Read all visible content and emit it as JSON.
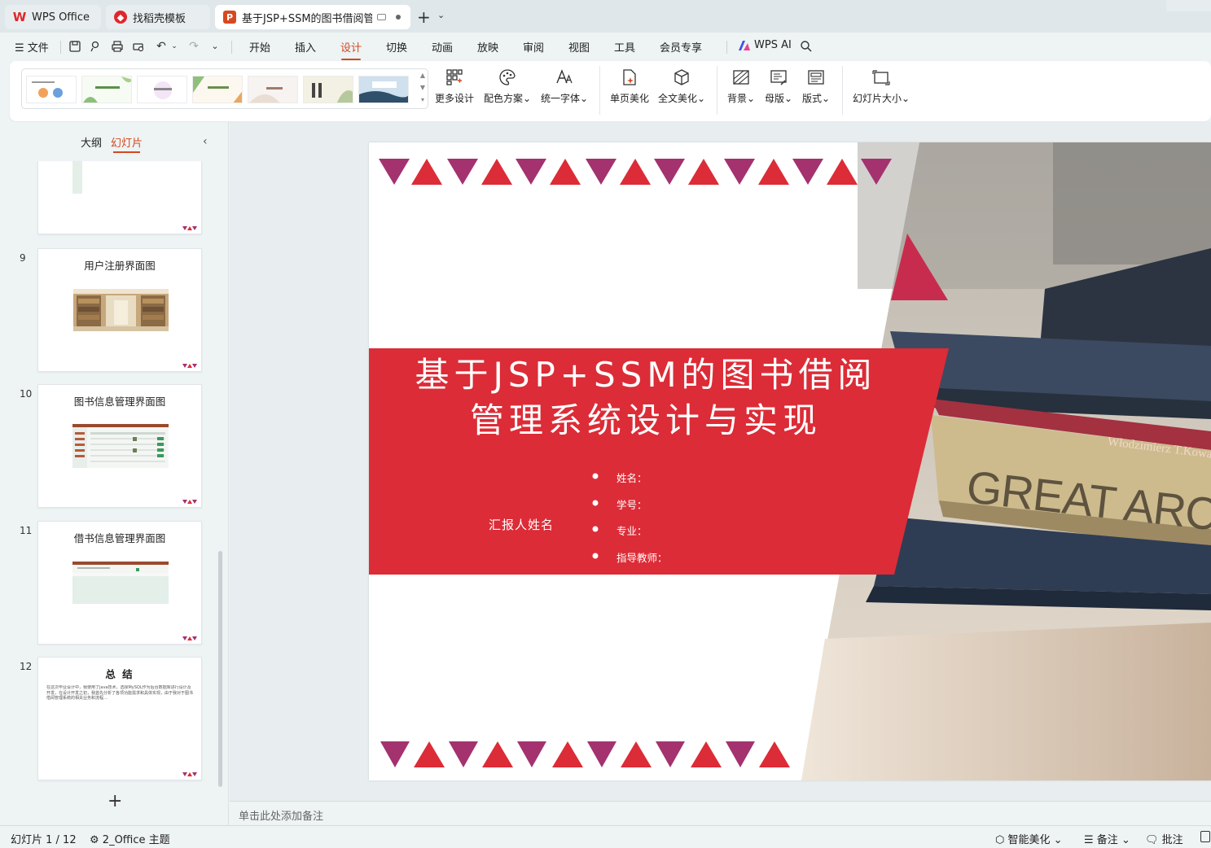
{
  "tabs": {
    "wps": "WPS Office",
    "template": "找稻壳模板",
    "document": "基于JSP+SSM的图书借阅管理"
  },
  "menu": {
    "file": "文件",
    "items": [
      "开始",
      "插入",
      "设计",
      "切换",
      "动画",
      "放映",
      "审阅",
      "视图",
      "工具",
      "会员专享"
    ],
    "active": "设计",
    "wps_ai": "WPS AI"
  },
  "ribbon": {
    "more_design": "更多设计",
    "color_scheme": "配色方案",
    "unify_font": "统一字体",
    "single_page_beautify": "单页美化",
    "full_beautify": "全文美化",
    "background": "背景",
    "master": "母版",
    "layout": "版式",
    "slide_size": "幻灯片大小"
  },
  "left_panel": {
    "tab_outline": "大纲",
    "tab_slides": "幻灯片",
    "active_tab": "幻灯片",
    "slides": [
      {
        "num": "9",
        "title": "用户注册界面图"
      },
      {
        "num": "10",
        "title": "图书信息管理界面图"
      },
      {
        "num": "11",
        "title": "借书信息管理界面图"
      },
      {
        "num": "12",
        "title": "总  结"
      }
    ],
    "summary_body": "在这次毕业设计中，我使用了java技术，选择MySQL作为后台数据库进行设计及开发，在设计开发之初，我首先分析了各项功能需求和具体实现，由于我对于图书借阅管理系统的相关业务和流程…"
  },
  "slide": {
    "title": "基于JSP+SSM的图书借阅管理系统设计与实现",
    "title_line1": "基于JSP+SSM的图书借阅",
    "title_line2": "管理系统设计与实现",
    "reporter": "汇报人姓名",
    "fields": [
      "姓名：",
      "学号：",
      "专业：",
      "指导教师："
    ],
    "book_spine_text": "GREAT ARCHIT",
    "book_author_text": "Włodzimierz T.Kowalski",
    "colors": {
      "red": "#dc2c37",
      "purple": "#a3326f",
      "white": "#ffffff"
    }
  },
  "notes_placeholder": "单击此处添加备注",
  "status": {
    "slide_counter": "幻灯片 1 / 12",
    "theme": "2_Office 主题",
    "smart_beautify": "智能美化",
    "notes": "备注",
    "comments": "批注"
  }
}
